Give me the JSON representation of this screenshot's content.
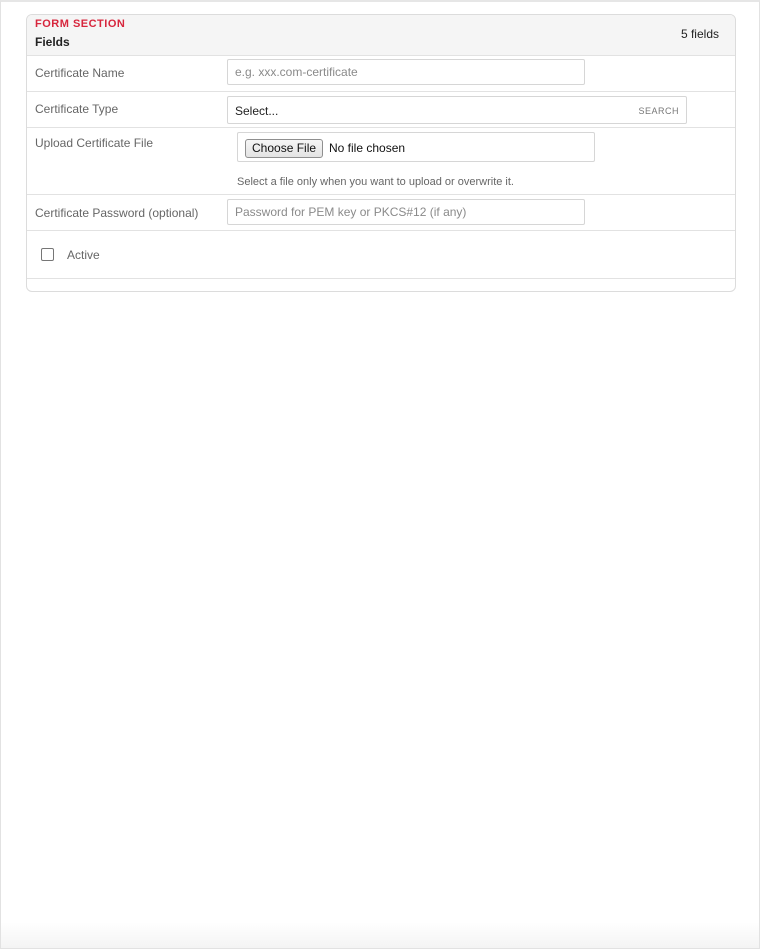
{
  "section": {
    "kicker": "FORM SECTION",
    "title": "Fields",
    "field_count": "5 fields"
  },
  "fields": {
    "certificate_name": {
      "label": "Certificate Name",
      "placeholder": "e.g. xxx.com-certificate",
      "value": ""
    },
    "certificate_type": {
      "label": "Certificate Type",
      "selected": "Select...",
      "search_label": "SEARCH"
    },
    "certificate_file": {
      "label": "Upload Certificate File",
      "button_label": "Choose File",
      "status": "No file chosen",
      "help": "Select a file only when you want to upload or overwrite it."
    },
    "certificate_password": {
      "label": "Certificate Password (optional)",
      "placeholder": "Password for PEM key or PKCS#12 (if any)",
      "value": ""
    },
    "active": {
      "label": "Active",
      "checked": false
    }
  }
}
